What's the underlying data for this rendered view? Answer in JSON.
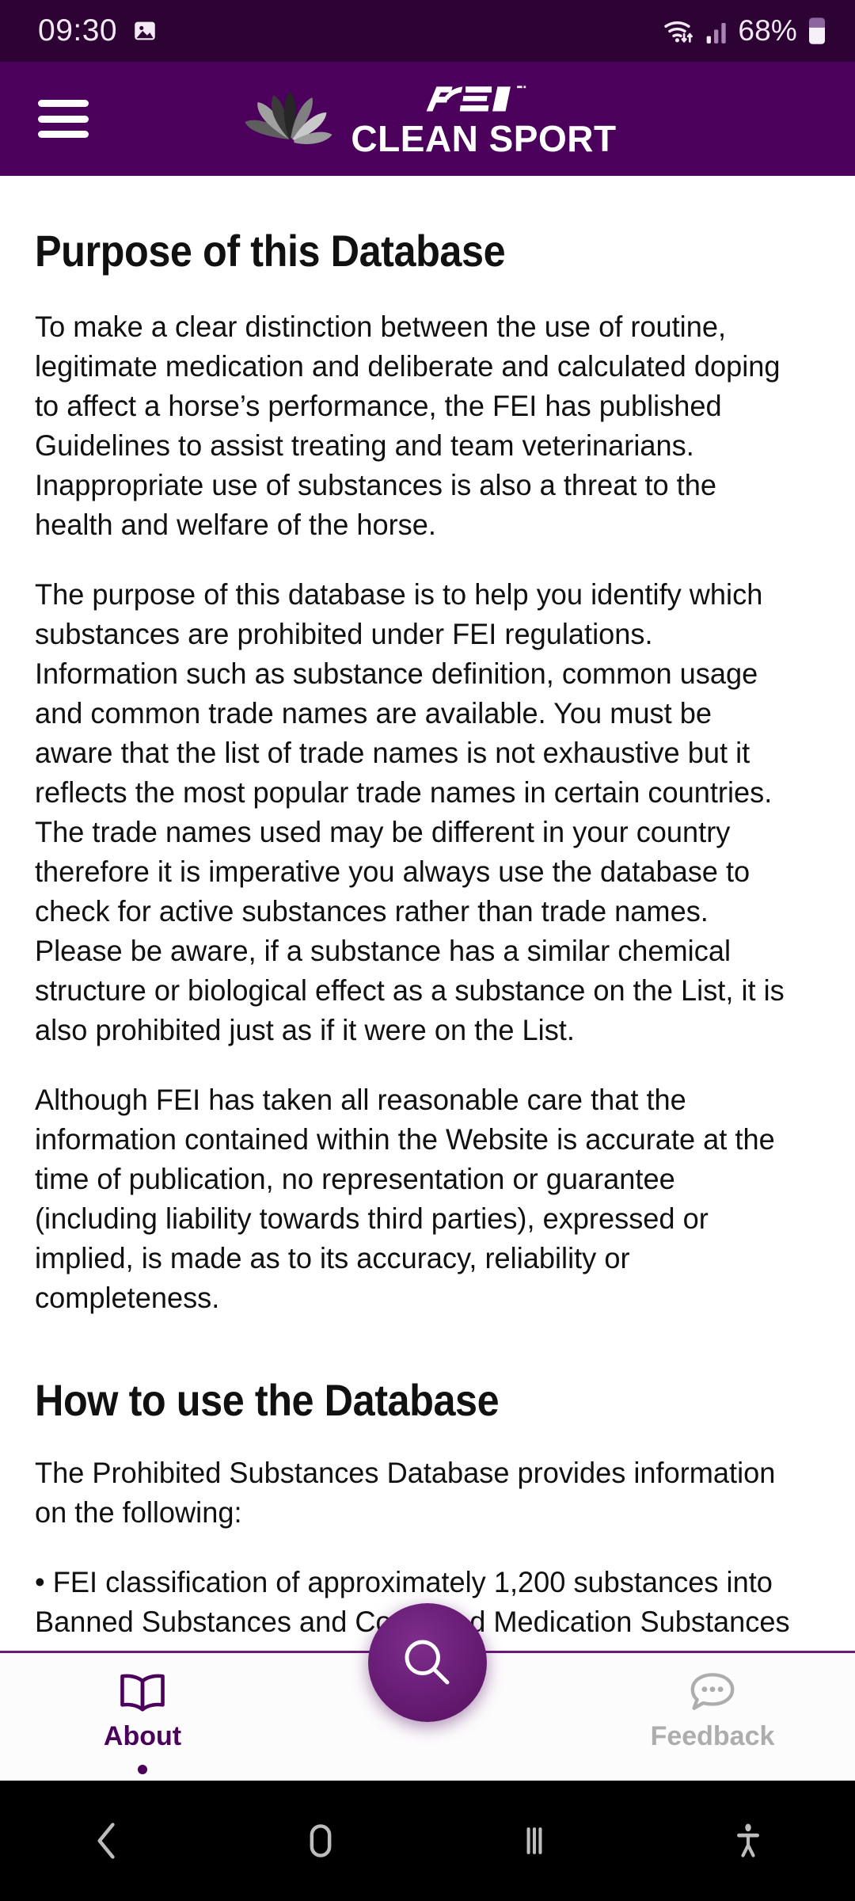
{
  "status_bar": {
    "clock": "09:30",
    "battery_percent": "68%",
    "icons": [
      "image-icon",
      "wifi-icon",
      "cellular-signal-icon",
      "battery-icon"
    ]
  },
  "header": {
    "menu_icon": "hamburger-menu-icon",
    "brand_primary": "FEI",
    "brand_secondary": "CLEAN SPORT",
    "logo_icon": "fei-lotus-logo"
  },
  "content": {
    "section1_title": "Purpose of this Database",
    "section1_paragraphs": [
      "To make a clear distinction between the use of routine, legitimate medication and deliberate and calculated doping to affect a horse’s performance, the FEI has published Guidelines to assist treating and team veterinarians. Inappropriate use of substances is also a threat to the health and welfare of the horse.",
      "The purpose of this database is to help you identify which substances are prohibited under FEI regulations. Information such as substance definition, common usage and common trade names are available. You must be aware that the list of trade names is not exhaustive but it reflects the most popular trade names in certain countries. The trade names used may be different in your country therefore it is imperative you always use the database to check for active substances rather than trade names. Please be aware, if a substance has a similar chemical structure or biological effect as a substance on the List, it is also prohibited just as if it were on the List.",
      "Although FEI has taken all reasonable care that the information contained within the Website is accurate at the time of publication, no representation or guarantee (including liability towards third parties), expressed or implied, is made as to its accuracy, reliability or completeness."
    ],
    "section2_title": "How to use the Database",
    "section2_intro": "The Prohibited Substances Database provides information on the following:",
    "section2_bullet1": "• FEI classification of approximately 1,200 substances into Banned Substances and Controlled Medication Substances"
  },
  "bottom_nav": {
    "about_label": "About",
    "about_icon": "open-book-icon",
    "feedback_label": "Feedback",
    "feedback_icon": "chat-bubble-icon",
    "search_fab_icon": "search-icon"
  },
  "system_nav": {
    "back_icon": "back-chevron-icon",
    "home_icon": "home-icon",
    "recents_icon": "recent-apps-icon",
    "accessibility_icon": "accessibility-icon"
  },
  "colors": {
    "status_bar": "#2d0333",
    "brand_purple": "#4b005c",
    "accent_purple": "#6b1f78",
    "inactive_gray": "#adadad"
  }
}
